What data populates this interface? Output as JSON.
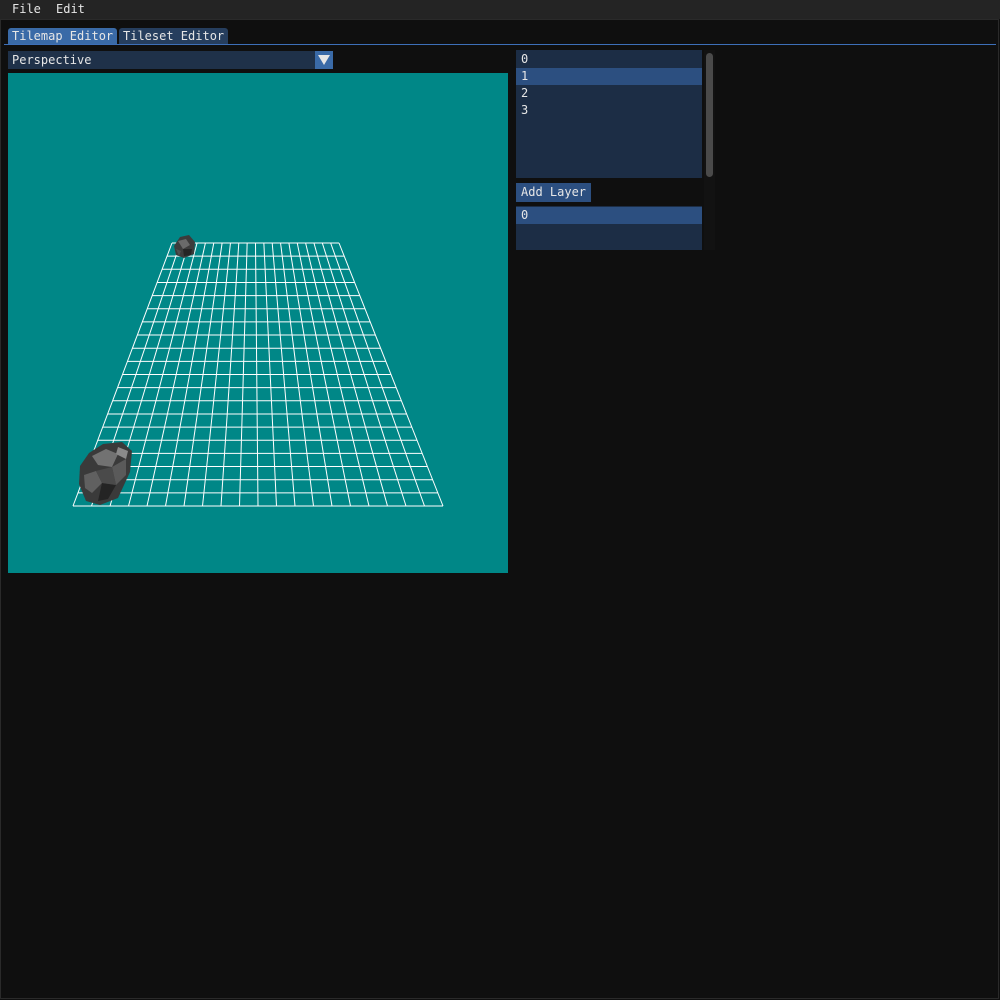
{
  "menu": {
    "file": "File",
    "edit": "Edit"
  },
  "tabs": [
    {
      "label": "Tilemap Editor",
      "active": true
    },
    {
      "label": "Tileset Editor",
      "active": false
    }
  ],
  "view_mode": {
    "selected": "Perspective"
  },
  "viewport": {
    "background": "#008787",
    "grid_color": "#ffffff",
    "grid_columns": 20,
    "grid_rows": 20,
    "objects": [
      "rock-tile",
      "rock-tile"
    ]
  },
  "layers": {
    "items": [
      "0",
      "1",
      "2",
      "3"
    ],
    "selected_index": 1,
    "add_label": "Add Layer"
  },
  "tilesets": {
    "items": [
      "0"
    ],
    "selected_index": 0
  },
  "colors": {
    "accent": "#3d6fb8",
    "selected": "#2c4f80",
    "list_bg": "#1c2d45",
    "app_bg": "#0f0f0f"
  }
}
